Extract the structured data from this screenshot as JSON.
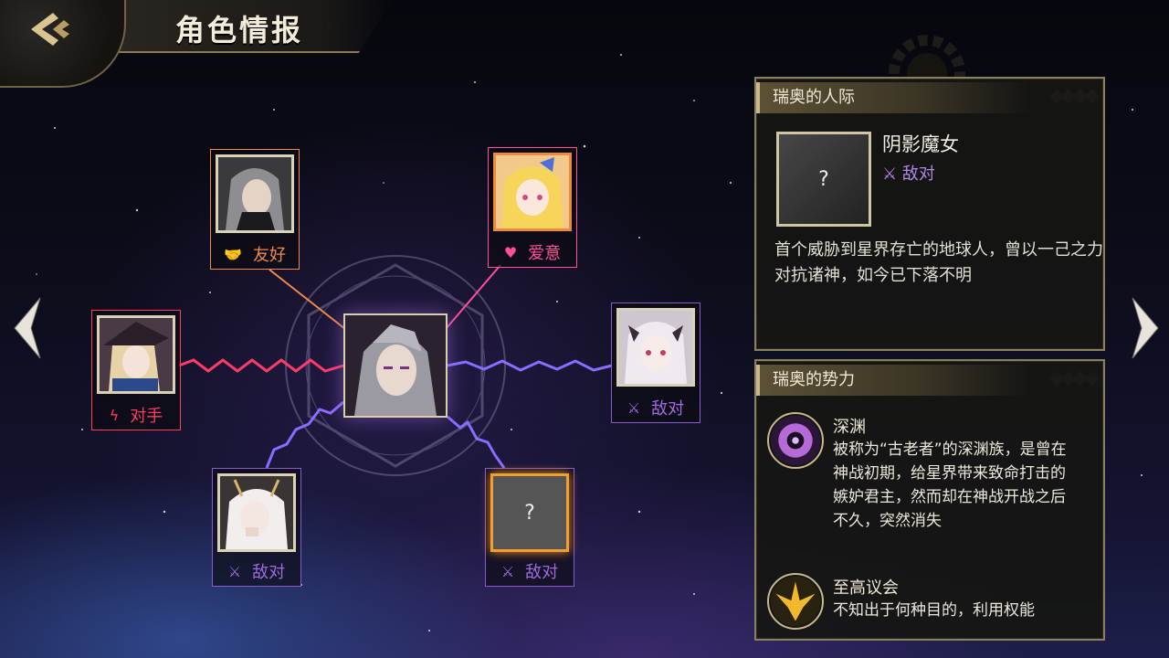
{
  "header": {
    "title": "角色情报"
  },
  "center": {
    "name": "瑞奥"
  },
  "relations": [
    {
      "id": "friendly",
      "label": "友好",
      "icon": "handshake-icon",
      "color": "#f08a4b",
      "portrait": "silver-haired-man"
    },
    {
      "id": "love",
      "label": "爱意",
      "icon": "heart-icon",
      "color": "#ff4f9a",
      "portrait": "blonde-girl"
    },
    {
      "id": "rival",
      "label": "对手",
      "icon": "lightning-icon",
      "color": "#ff3a5a",
      "portrait": "blonde-hat-girl"
    },
    {
      "id": "enemy-right",
      "label": "敌对",
      "icon": "crossed-swords-icon",
      "color": "#a06ae0",
      "portrait": "white-haired-horned-girl"
    },
    {
      "id": "enemy-bottom-left",
      "label": "敌对",
      "icon": "crossed-swords-icon",
      "color": "#a06ae0",
      "portrait": "white-haired-antlered-girl"
    },
    {
      "id": "enemy-unknown",
      "label": "敌对",
      "icon": "crossed-swords-icon",
      "color": "#a06ae0",
      "portrait": "?"
    }
  ],
  "relation_panel": {
    "title": "瑞奥的人际",
    "selected": {
      "portrait": "?",
      "name": "阴影魔女",
      "type": "敌对",
      "description": "首个威胁到星界存亡的地球人，曾以一己之力对抗诸神，如今已下落不明"
    }
  },
  "faction_panel": {
    "title": "瑞奥的势力",
    "factions": [
      {
        "name": "深渊",
        "emblem": "abyss-eye-emblem",
        "description": "被称为“古老者”的深渊族，是曾在神战初期，给星界带来致命打击的嫉妒君主，然而却在神战开战之后不久，突然消失"
      },
      {
        "name": "至高议会",
        "emblem": "supreme-council-emblem",
        "description": "不知出于何种目的，利用权能"
      }
    ]
  },
  "colors": {
    "gold": "#c9b98a",
    "enemy": "#a06ae0",
    "love": "#ff4f9a",
    "rival": "#ff3a5a",
    "friendly": "#f08a4b"
  }
}
